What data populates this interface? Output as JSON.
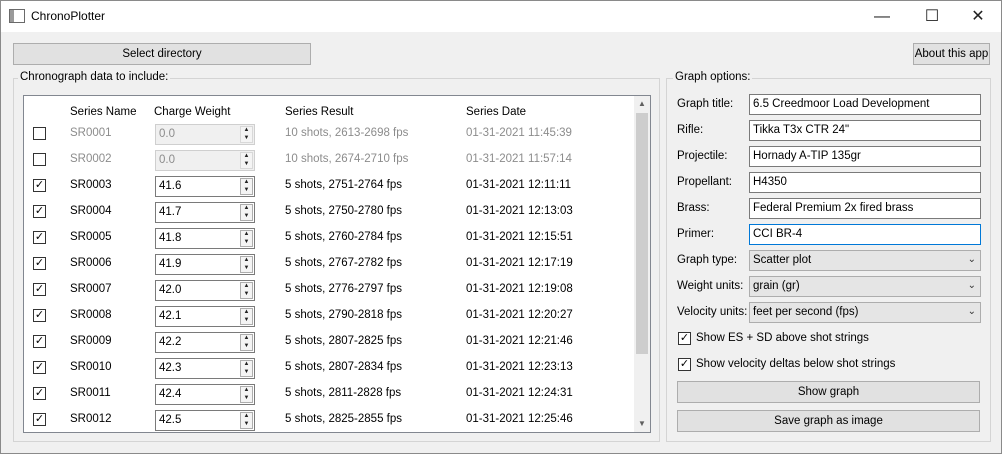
{
  "window": {
    "title": "ChronoPlotter",
    "minimize_glyph": "—",
    "maximize_glyph": "☐",
    "close_glyph": "✕"
  },
  "toolbar": {
    "select_directory_label": "Select directory",
    "about_label": "About this app"
  },
  "data_group": {
    "label": "Chronograph data to include:",
    "columns": {
      "series_name": "Series Name",
      "charge_weight": "Charge Weight",
      "series_result": "Series Result",
      "series_date": "Series Date"
    },
    "rows": [
      {
        "checked": false,
        "name": "SR0001",
        "charge": "0.0",
        "result": "10 shots, 2613-2698 fps",
        "date": "01-31-2021 11:45:39"
      },
      {
        "checked": false,
        "name": "SR0002",
        "charge": "0.0",
        "result": "10 shots, 2674-2710 fps",
        "date": "01-31-2021 11:57:14"
      },
      {
        "checked": true,
        "name": "SR0003",
        "charge": "41.6",
        "result": "5 shots, 2751-2764 fps",
        "date": "01-31-2021 12:11:11"
      },
      {
        "checked": true,
        "name": "SR0004",
        "charge": "41.7",
        "result": "5 shots, 2750-2780 fps",
        "date": "01-31-2021 12:13:03"
      },
      {
        "checked": true,
        "name": "SR0005",
        "charge": "41.8",
        "result": "5 shots, 2760-2784 fps",
        "date": "01-31-2021 12:15:51"
      },
      {
        "checked": true,
        "name": "SR0006",
        "charge": "41.9",
        "result": "5 shots, 2767-2782 fps",
        "date": "01-31-2021 12:17:19"
      },
      {
        "checked": true,
        "name": "SR0007",
        "charge": "42.0",
        "result": "5 shots, 2776-2797 fps",
        "date": "01-31-2021 12:19:08"
      },
      {
        "checked": true,
        "name": "SR0008",
        "charge": "42.1",
        "result": "5 shots, 2790-2818 fps",
        "date": "01-31-2021 12:20:27"
      },
      {
        "checked": true,
        "name": "SR0009",
        "charge": "42.2",
        "result": "5 shots, 2807-2825 fps",
        "date": "01-31-2021 12:21:46"
      },
      {
        "checked": true,
        "name": "SR0010",
        "charge": "42.3",
        "result": "5 shots, 2807-2834 fps",
        "date": "01-31-2021 12:23:13"
      },
      {
        "checked": true,
        "name": "SR0011",
        "charge": "42.4",
        "result": "5 shots, 2811-2828 fps",
        "date": "01-31-2021 12:24:31"
      },
      {
        "checked": true,
        "name": "SR0012",
        "charge": "42.5",
        "result": "5 shots, 2825-2855 fps",
        "date": "01-31-2021 12:25:46"
      }
    ]
  },
  "options_group": {
    "label": "Graph options:",
    "fields": {
      "graph_title": {
        "label": "Graph title:",
        "value": "6.5 Creedmoor Load Development"
      },
      "rifle": {
        "label": "Rifle:",
        "value": "Tikka T3x CTR 24\""
      },
      "projectile": {
        "label": "Projectile:",
        "value": "Hornady A-TIP 135gr"
      },
      "propellant": {
        "label": "Propellant:",
        "value": "H4350"
      },
      "brass": {
        "label": "Brass:",
        "value": "Federal Premium 2x fired brass"
      },
      "primer": {
        "label": "Primer:",
        "value": "CCI BR-4"
      }
    },
    "graph_type": {
      "label": "Graph type:",
      "value": "Scatter plot"
    },
    "weight_units": {
      "label": "Weight units:",
      "value": "grain (gr)"
    },
    "velocity_units": {
      "label": "Velocity units:",
      "value": "feet per second (fps)"
    },
    "show_es_sd": {
      "checked": true,
      "label": "Show ES + SD above shot strings"
    },
    "show_velocity_deltas": {
      "checked": true,
      "label": "Show velocity deltas below shot strings"
    },
    "show_graph_label": "Show graph",
    "save_graph_label": "Save graph as image"
  },
  "icons": {
    "check": "✓",
    "spin_up": "▲",
    "spin_down": "▼",
    "combo_chevron": "⌄",
    "scroll_up": "▲",
    "scroll_down": "▼"
  }
}
